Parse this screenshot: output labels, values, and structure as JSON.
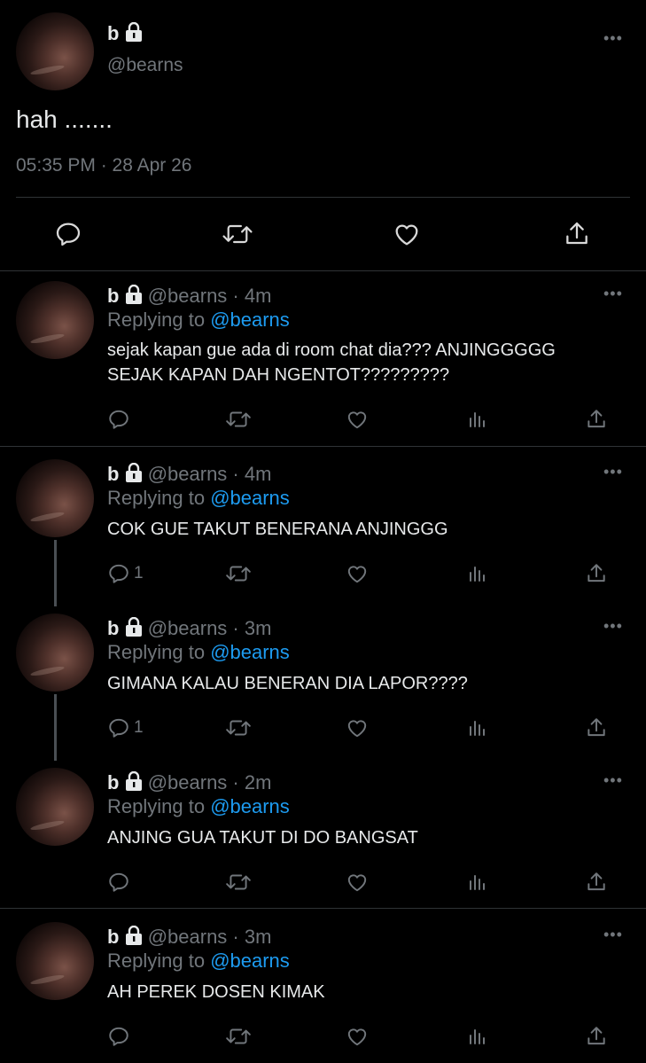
{
  "main": {
    "name": "b",
    "handle": "@bearns",
    "text": "hah .......",
    "timestamp": "05:35 PM · 28 Apr 26"
  },
  "replies": [
    {
      "name": "b",
      "meta": "@bearns · 4m",
      "replying_prefix": "Replying to ",
      "replying_to": "@bearns",
      "lines": [
        "sejak kapan gue ada di room chat dia??? ANJINGGGGG",
        "SEJAK KAPAN DAH NGENTOT?????????"
      ],
      "reply_count": ""
    },
    {
      "name": "b",
      "meta": "@bearns · 4m",
      "replying_prefix": "Replying to ",
      "replying_to": "@bearns",
      "lines": [
        "COK GUE TAKUT BENERANA ANJINGGG"
      ],
      "reply_count": "1"
    },
    {
      "name": "b",
      "meta": "@bearns · 3m",
      "replying_prefix": "Replying to ",
      "replying_to": "@bearns",
      "lines": [
        "GIMANA KALAU BENERAN DIA LAPOR????"
      ],
      "reply_count": "1"
    },
    {
      "name": "b",
      "meta": "@bearns · 2m",
      "replying_prefix": "Replying to ",
      "replying_to": "@bearns",
      "lines": [
        "ANJING GUA TAKUT DI DO BANGSAT"
      ],
      "reply_count": ""
    },
    {
      "name": "b",
      "meta": "@bearns · 3m",
      "replying_prefix": "Replying to ",
      "replying_to": "@bearns",
      "lines": [
        "AH PEREK DOSEN KIMAK"
      ],
      "reply_count": ""
    }
  ],
  "icons": {
    "reply": "reply-icon",
    "retweet": "retweet-icon",
    "like": "like-icon",
    "views": "views-icon",
    "share": "share-icon",
    "more": "more-icon",
    "lock": "lock-icon"
  },
  "colors": {
    "background": "#000000",
    "text": "#e7e9ea",
    "muted": "#71767b",
    "accent": "#1d9bf0",
    "divider": "#2f3336"
  }
}
